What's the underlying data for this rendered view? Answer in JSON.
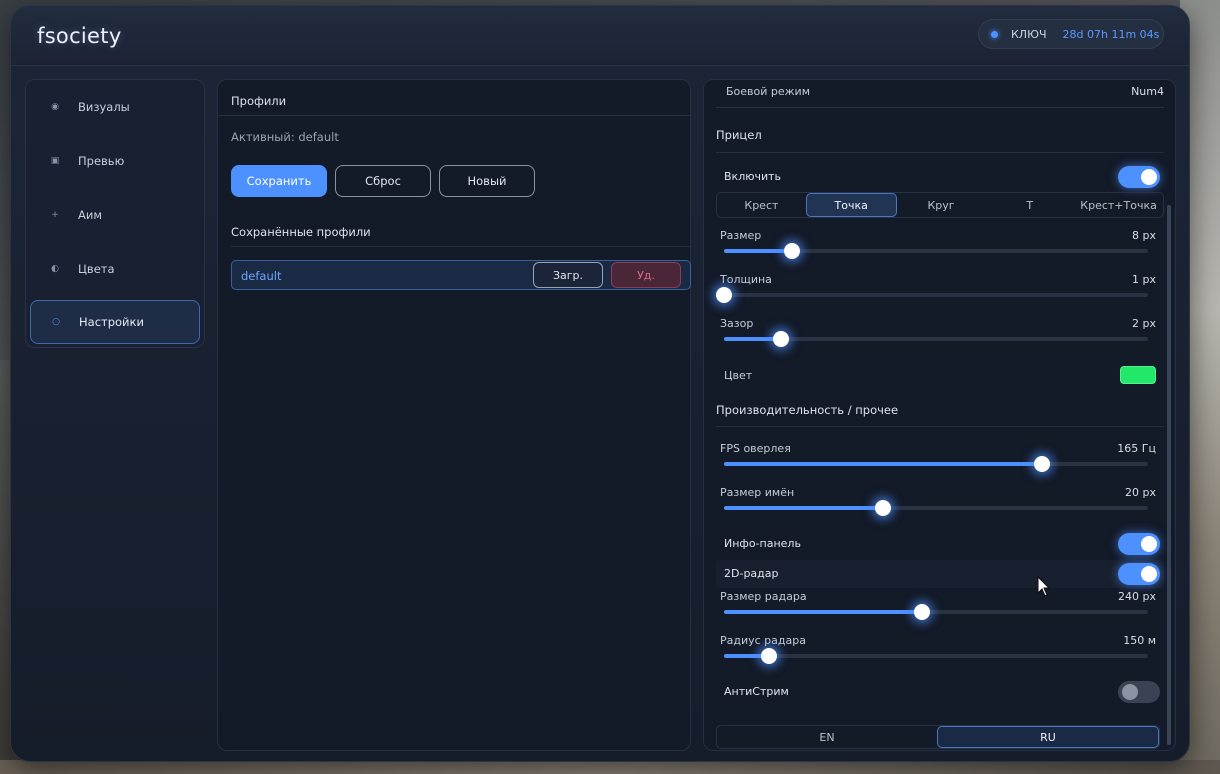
{
  "app": {
    "brand": "fsociety",
    "key_label": "КЛЮЧ",
    "key_time": "28d 07h 11m 04s"
  },
  "sidebar": {
    "items": [
      {
        "label": "Визуалы",
        "icon": "dot-icon"
      },
      {
        "label": "Превью",
        "icon": "square-icon"
      },
      {
        "label": "Аим",
        "icon": "plus-icon"
      },
      {
        "label": "Цвета",
        "icon": "half-circle-icon"
      },
      {
        "label": "Настройки",
        "icon": "ring-icon",
        "active": true
      }
    ]
  },
  "profiles": {
    "title": "Профили",
    "active_text": "Активный: default",
    "save_label": "Сохранить",
    "reset_label": "Сброс",
    "new_label": "Новый",
    "saved_title": "Сохранённые профили",
    "items": [
      {
        "name": "default",
        "load_label": "Загр.",
        "delete_label": "Уд."
      }
    ]
  },
  "settings": {
    "combat_mode": {
      "label": "Боевой режим",
      "value": "Num4"
    },
    "crosshair": {
      "title": "Прицел",
      "enable_label": "Включить",
      "enabled": true,
      "styles": [
        "Крест",
        "Точка",
        "Круг",
        "T",
        "Крест+Точка"
      ],
      "selected_style": "Точка",
      "size": {
        "label": "Размер",
        "value": "8 px",
        "fraction": 0.16
      },
      "thickness": {
        "label": "Толщина",
        "value": "1 px",
        "fraction": 0.0
      },
      "gap": {
        "label": "Зазор",
        "value": "2 px",
        "fraction": 0.135
      },
      "color_label": "Цвет",
      "color": "#22e86a"
    },
    "performance": {
      "title": "Производительность / прочее",
      "fps": {
        "label": "FPS оверлея",
        "value": "165  Гц",
        "fraction": 0.75
      },
      "name_size": {
        "label": "Размер имён",
        "value": "20 px",
        "fraction": 0.375
      },
      "info_panel": {
        "label": "Инфо-панель",
        "enabled": true
      },
      "radar_2d": {
        "label": "2D-радар",
        "enabled": true
      },
      "radar_size": {
        "label": "Размер радара",
        "value": "240 px",
        "fraction": 0.467
      },
      "radar_radius": {
        "label": "Радиус радара",
        "value": "150  м",
        "fraction": 0.106
      },
      "antistream": {
        "label": "АнтиСтрим",
        "enabled": false
      }
    },
    "languages": [
      "EN",
      "RU"
    ],
    "selected_language": "RU"
  },
  "colors": {
    "accent": "#4d90ff",
    "danger": "#e06b86",
    "panel_bg": "#131a28"
  }
}
